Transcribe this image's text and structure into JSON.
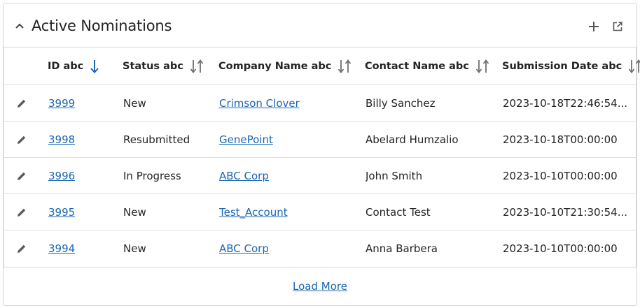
{
  "panel": {
    "title": "Active Nominations",
    "icons": [
      "chevron-up-icon",
      "plus-icon",
      "open-in-new-window-icon"
    ]
  },
  "table": {
    "columns": [
      {
        "label": "ID abc",
        "sort": "descending"
      },
      {
        "label": "Status abc",
        "sort": "none"
      },
      {
        "label": "Company Name abc",
        "sort": "none"
      },
      {
        "label": "Contact Name abc",
        "sort": "none"
      },
      {
        "label": "Submission Date abc",
        "sort": "none"
      }
    ],
    "rows": [
      {
        "id": "3999",
        "status": "New",
        "company": "Crimson Clover",
        "contact": "Billy Sanchez",
        "date": "2023-10-18T22:46:54..."
      },
      {
        "id": "3998",
        "status": "Resubmitted",
        "company": "GenePoint",
        "contact": "Abelard Humzalio",
        "date": "2023-10-18T00:00:00"
      },
      {
        "id": "3996",
        "status": "In Progress",
        "company": "ABC Corp",
        "contact": "John Smith",
        "date": "2023-10-10T00:00:00"
      },
      {
        "id": "3995",
        "status": "New",
        "company": "Test_Account",
        "contact": "Contact Test",
        "date": "2023-10-10T21:30:54..."
      },
      {
        "id": "3994",
        "status": "New",
        "company": "ABC Corp",
        "contact": "Anna Barbera",
        "date": "2023-10-10T00:00:00"
      }
    ]
  },
  "footer": {
    "load_more_label": "Load More"
  },
  "colors": {
    "link": "#1a66b3",
    "sort_active": "#1a66b3",
    "sort_inactive": "#707070",
    "border": "#d6d6d6"
  }
}
